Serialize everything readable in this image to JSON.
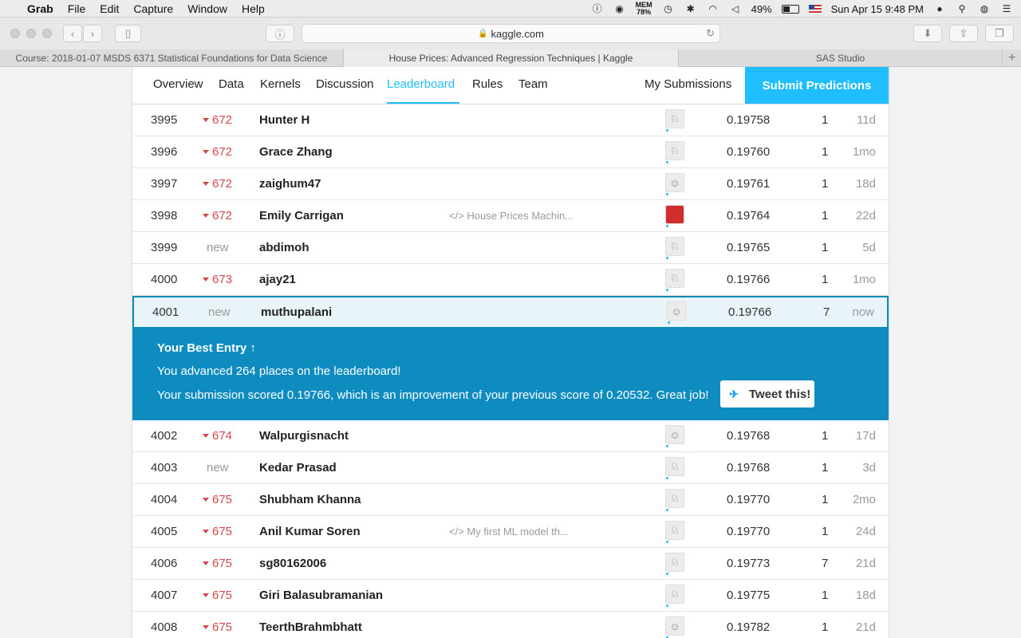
{
  "menubar": {
    "app_name": "Grab",
    "menus": [
      "File",
      "Edit",
      "Capture",
      "Window",
      "Help"
    ],
    "mem_label": "MEM",
    "mem_value": "78%",
    "battery_text": "49%",
    "battery_level": 0.49,
    "clock": "Sun Apr 15  9:48 PM"
  },
  "browser": {
    "url": "kaggle.com",
    "tabs": [
      {
        "label": "Course: 2018-01-07 MSDS 6371 Statistical Foundations for Data Science"
      },
      {
        "label": "House Prices: Advanced Regression Techniques | Kaggle"
      },
      {
        "label": "SAS Studio"
      }
    ],
    "new_tab": "+"
  },
  "nav": {
    "items": [
      "Overview",
      "Data",
      "Kernels",
      "Discussion",
      "Leaderboard",
      "Rules",
      "Team"
    ],
    "active": "Leaderboard",
    "my_submissions": "My Submissions",
    "submit": "Submit Predictions"
  },
  "rows_before": [
    {
      "rank": "3995",
      "change": "672",
      "name": "Hunter H",
      "kernel": "",
      "score": "0.19758",
      "entries": "1",
      "last": "11d",
      "avatar": "default"
    },
    {
      "rank": "3996",
      "change": "672",
      "name": "Grace Zhang",
      "kernel": "",
      "score": "0.19760",
      "entries": "1",
      "last": "1mo",
      "avatar": "default"
    },
    {
      "rank": "3997",
      "change": "672",
      "name": "zaighum47",
      "kernel": "",
      "score": "0.19761",
      "entries": "1",
      "last": "18d",
      "avatar": "photo"
    },
    {
      "rank": "3998",
      "change": "672",
      "name": "Emily Carrigan",
      "kernel": "House Prices Machin...",
      "score": "0.19764",
      "entries": "1",
      "last": "22d",
      "avatar": "red"
    },
    {
      "rank": "3999",
      "change": "new",
      "name": "abdimoh",
      "kernel": "",
      "score": "0.19765",
      "entries": "1",
      "last": "5d",
      "avatar": "default"
    },
    {
      "rank": "4000",
      "change": "673",
      "name": "ajay21",
      "kernel": "",
      "score": "0.19766",
      "entries": "1",
      "last": "1mo",
      "avatar": "default"
    }
  ],
  "my_row": {
    "rank": "4001",
    "change": "new",
    "name": "muthupalani",
    "score": "0.19766",
    "entries": "7",
    "last": "now"
  },
  "best_entry": {
    "heading": "Your Best Entry",
    "line1": "You advanced 264 places on the leaderboard!",
    "line2": "Your submission scored 0.19766, which is an improvement of your previous score of 0.20532. Great job!",
    "tweet": "Tweet this!"
  },
  "rows_after": [
    {
      "rank": "4002",
      "change": "674",
      "name": "Walpurgisnacht",
      "kernel": "",
      "score": "0.19768",
      "entries": "1",
      "last": "17d",
      "avatar": "photo"
    },
    {
      "rank": "4003",
      "change": "new",
      "name": "Kedar Prasad",
      "kernel": "",
      "score": "0.19768",
      "entries": "1",
      "last": "3d",
      "avatar": "default"
    },
    {
      "rank": "4004",
      "change": "675",
      "name": "Shubham Khanna",
      "kernel": "",
      "score": "0.19770",
      "entries": "1",
      "last": "2mo",
      "avatar": "default"
    },
    {
      "rank": "4005",
      "change": "675",
      "name": "Anil Kumar Soren",
      "kernel": "My first ML model th...",
      "score": "0.19770",
      "entries": "1",
      "last": "24d",
      "avatar": "default"
    },
    {
      "rank": "4006",
      "change": "675",
      "name": "sg80162006",
      "kernel": "",
      "score": "0.19773",
      "entries": "7",
      "last": "21d",
      "avatar": "default"
    },
    {
      "rank": "4007",
      "change": "675",
      "name": "Giri Balasubramanian",
      "kernel": "",
      "score": "0.19775",
      "entries": "1",
      "last": "18d",
      "avatar": "default"
    },
    {
      "rank": "4008",
      "change": "675",
      "name": "TeerthBrahmbhatt",
      "kernel": "",
      "score": "0.19782",
      "entries": "1",
      "last": "21d",
      "avatar": "photo"
    }
  ],
  "colors": {
    "accent": "#20beff",
    "banner": "#0e8cbf",
    "rank_down": "#d1494c"
  }
}
